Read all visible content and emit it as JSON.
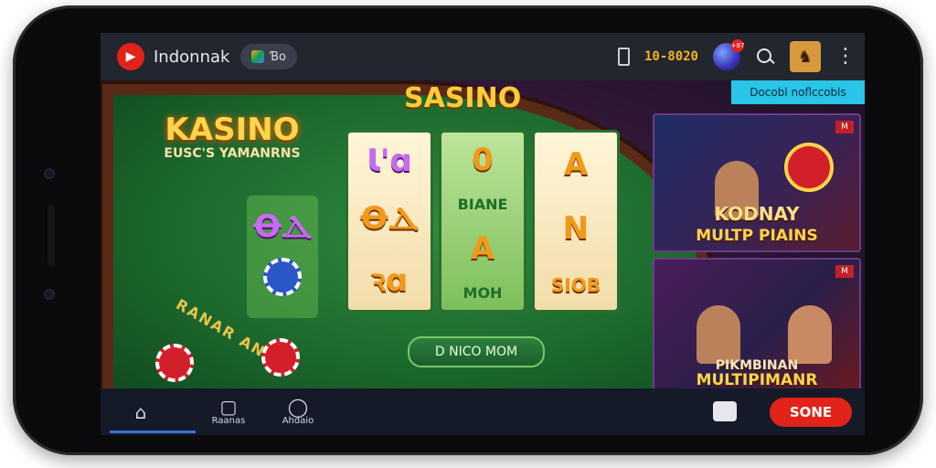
{
  "topbar": {
    "brand": "Indonnak",
    "pill_label": "Ɓo",
    "balance": "10-8020",
    "notif_badge": "+87"
  },
  "content": {
    "casino_title": "KASINO",
    "casino_subtitle": "EUSC'S YAMANRNS",
    "sasino_title": "SASINO",
    "reels": [
      [
        "Ɩ'ɑ",
        "ꝊⲆ",
        "ꝛɑ"
      ],
      [
        "0",
        "BIANE",
        "A",
        "MOH"
      ],
      [
        "A",
        "N",
        "SIOB"
      ]
    ],
    "left_symbol": "ꝊⲆ",
    "table_text": "RANAR ANN",
    "nico_button": "D NICO MOM",
    "promo_tag": "Docobl noflccobls",
    "card1": {
      "title": "KODNAY",
      "subtitle": "MULTP PIAINS",
      "badge": "M"
    },
    "card2": {
      "title": "PIKMBINAN",
      "subtitle": "MULTIPIMANR",
      "badge": "M"
    }
  },
  "bottom_nav": {
    "home_icon": "home-icon",
    "item2_label": "Raanas",
    "item3_label": "Ahdaio",
    "done_button": "SONE"
  },
  "colors": {
    "accent_red": "#e2231a",
    "table_green": "#1d6b2e",
    "gold": "#ffd54a"
  }
}
